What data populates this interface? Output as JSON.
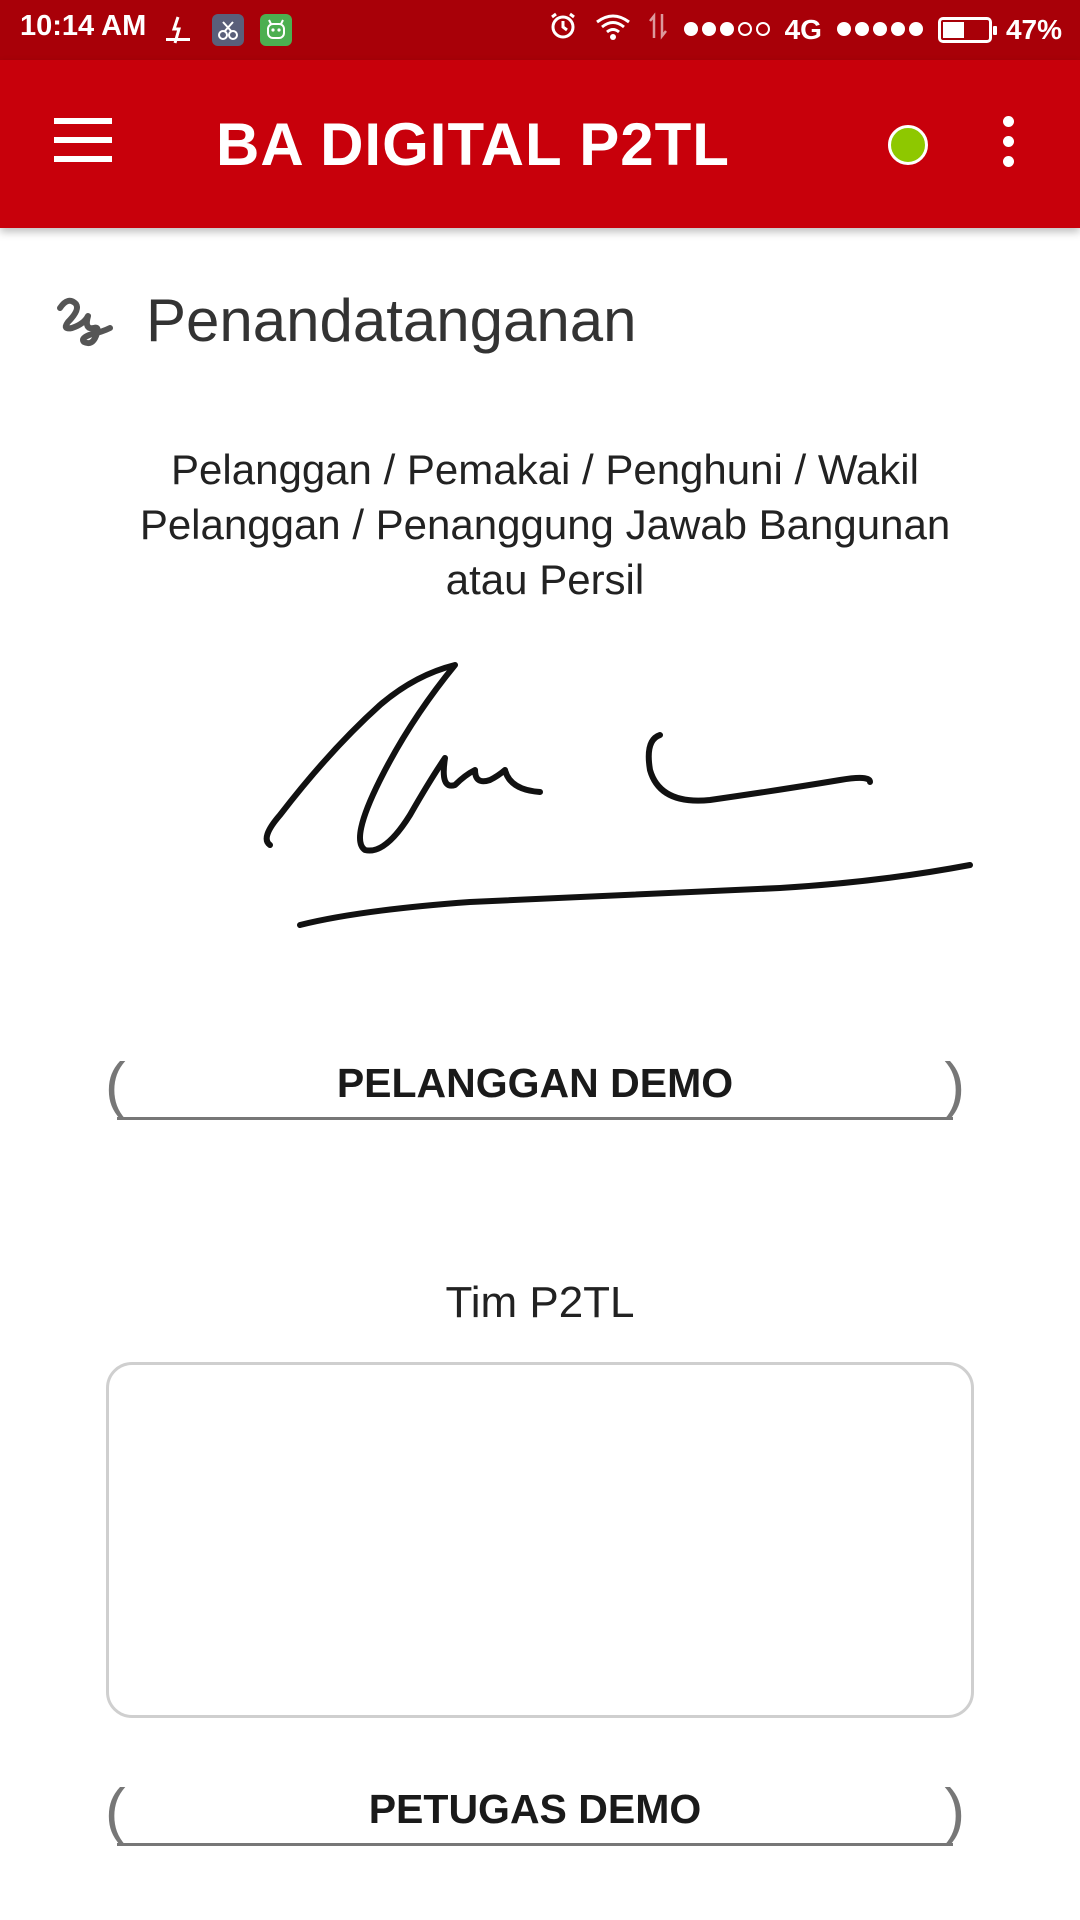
{
  "status_bar": {
    "time": "10:14 AM",
    "network": "4G",
    "battery_percent_label": "47%",
    "battery_level": 0.47,
    "notification_icons": [
      "p2tl-app-icon",
      "scissors-app-icon",
      "android-app-icon"
    ]
  },
  "app_bar": {
    "title": "BA DIGITAL P2TL",
    "status_color": "#8ec800"
  },
  "section": {
    "title": "Penandatanganan"
  },
  "customer": {
    "caption": "Pelanggan / Pemakai / Penghuni / Wakil Pelanggan / Penanggung Jawab Bangunan atau Persil",
    "name": "PELANGGAN DEMO"
  },
  "officer": {
    "caption": "Tim P2TL",
    "name": "PETUGAS DEMO"
  },
  "labels": {
    "paren_open": "(",
    "paren_close": ")"
  },
  "colors": {
    "status_bar": "#a80008",
    "app_bar": "#c8000b"
  }
}
